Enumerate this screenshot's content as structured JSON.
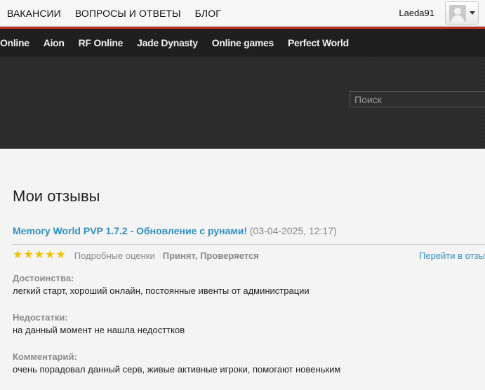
{
  "topnav": {
    "items": [
      "ВАКАНСИИ",
      "ВОПРОСЫ И ОТВЕТЫ",
      "БЛОГ"
    ]
  },
  "user": {
    "name": "Laeda91"
  },
  "gamenav": {
    "items": [
      "Online",
      "Aion",
      "RF Online",
      "Jade Dynasty",
      "Online games",
      "Perfect World"
    ]
  },
  "search": {
    "placeholder": "Поиск"
  },
  "page": {
    "title": "Мои отзывы"
  },
  "review": {
    "title": "Memory World PVP 1.7.2 - Обновление с рунами!",
    "date": "(03-04-2025, 12:17)",
    "stars": 5,
    "detail_label": "Подробные оценки",
    "status": "Принят, Проверяется",
    "goto_label": "Перейти в отзы",
    "pros_label": "Достоинства:",
    "pros": "легкий старт, хороший онлайн, постоянные ивенты от администрации",
    "cons_label": "Недостатки:",
    "cons": "на данный момент не нашла недосттков",
    "comment_label": "Комментарий:",
    "comment": "очень порадовал данный серв, живые активные игроки, помогают новеньким"
  }
}
